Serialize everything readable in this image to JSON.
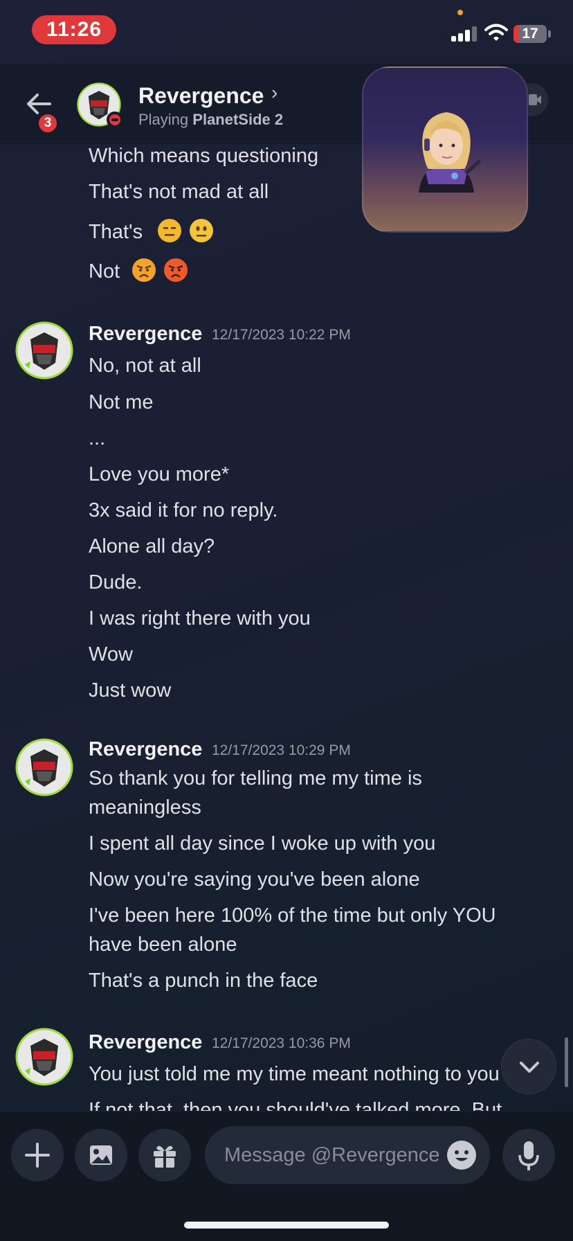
{
  "status_bar": {
    "time": "11:26",
    "battery": "17",
    "battery_level": 0.17
  },
  "header": {
    "back_badge": "3",
    "name": "Revergence",
    "chevron": "›",
    "activity_prefix": "Playing",
    "activity_game": "PlanetSide 2"
  },
  "top_lines": [
    "Which means questioning",
    "That's not mad at all",
    "That's",
    "Not"
  ],
  "groups": [
    {
      "author": "Revergence",
      "timestamp": "12/17/2023 10:22 PM",
      "lines": [
        "No, not at all",
        "Not me",
        "...",
        "Love you more*",
        "3x said it for no reply.",
        "Alone all day?",
        "Dude.",
        "I was right there with you",
        "Wow",
        "Just wow"
      ]
    },
    {
      "author": "Revergence",
      "timestamp": "12/17/2023 10:29 PM",
      "lines": [
        "So thank you for telling me my time is meaningless",
        "I spent all day since I woke up with you",
        "Now you're saying you've been alone",
        "I've been here 100% of the time but only YOU have been alone",
        "That's a punch in the face"
      ]
    },
    {
      "author": "Revergence",
      "timestamp": "12/17/2023 10:36 PM",
      "lines": [
        "You just told me my time meant nothing to you",
        "If not that, then you should've talked more. But"
      ]
    }
  ],
  "composer": {
    "placeholder": "Message @Revergence"
  },
  "colors": {
    "accent_red": "#e0393b",
    "background": "#1a1f33",
    "text": "#dfe1e6",
    "muted": "#949ba4"
  },
  "icons": [
    "back-arrow-icon",
    "video-call-icon",
    "plus-icon",
    "image-icon",
    "gift-icon",
    "emoji-icon",
    "microphone-icon",
    "chevron-down-icon"
  ]
}
